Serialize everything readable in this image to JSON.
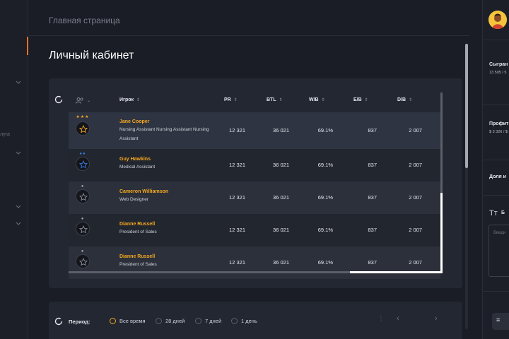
{
  "sidebar": {
    "label_fragment": "луга"
  },
  "header": {
    "breadcrumb": "Главная страница",
    "page_title": "Личный кабинет"
  },
  "table": {
    "columns": {
      "player": "Игрок",
      "pr": "PR",
      "btl": "BTL",
      "wb": "W/B",
      "eb": "E/B",
      "db": "D/B"
    },
    "rows": [
      {
        "name": "Jane Cooper",
        "role": "Nursing Assistant Nursing Assistant Nursing Assistant",
        "pr": "12 321",
        "btl": "36 021",
        "wb": "69.1%",
        "eb": "837",
        "db": "2 007",
        "rank_stars": "★★★",
        "star_color": "#f4a820"
      },
      {
        "name": "Guy Hawkins",
        "role": "Medical Assistant",
        "pr": "12 321",
        "btl": "36 021",
        "wb": "69.1%",
        "eb": "837",
        "db": "2 007",
        "rank_stars": "●●",
        "star_color": "#3b7be0"
      },
      {
        "name": "Cameron Williamson",
        "role": "Web Designer",
        "pr": "12 321",
        "btl": "36 021",
        "wb": "69.1%",
        "eb": "837",
        "db": "2 007",
        "rank_stars": "●",
        "star_color": "#a4a8b2"
      },
      {
        "name": "Dianne Russell",
        "role": "President of Sales",
        "pr": "12 321",
        "btl": "36 021",
        "wb": "69.1%",
        "eb": "837",
        "db": "2 007",
        "rank_stars": "●",
        "star_color": "#a4a8b2"
      },
      {
        "name": "Dianne Russell",
        "role": "President of Sales",
        "pr": "12 321",
        "btl": "36 021",
        "wb": "69.1%",
        "eb": "837",
        "db": "2 007",
        "rank_stars": "●",
        "star_color": "#a4a8b2"
      }
    ]
  },
  "period": {
    "label": "Период:",
    "options": [
      "Все время",
      "28 дней",
      "7 дней",
      "1 день"
    ],
    "selected": "Все время"
  },
  "right_panel": {
    "played_title": "Сыгран",
    "played_sub": "13 505 / 5",
    "profit_title": "Профит",
    "profit_sub": "$ 3 326 / $",
    "share_title": "Доля и",
    "bold_fragment": "Б",
    "textarea_placeholder": "Введи",
    "text_format_icon": "Tт",
    "menu_button_icon": "≡"
  },
  "colors": {
    "accent": "#f4a820",
    "active_marker": "#e0712b",
    "blue_rank": "#3b7be0"
  }
}
